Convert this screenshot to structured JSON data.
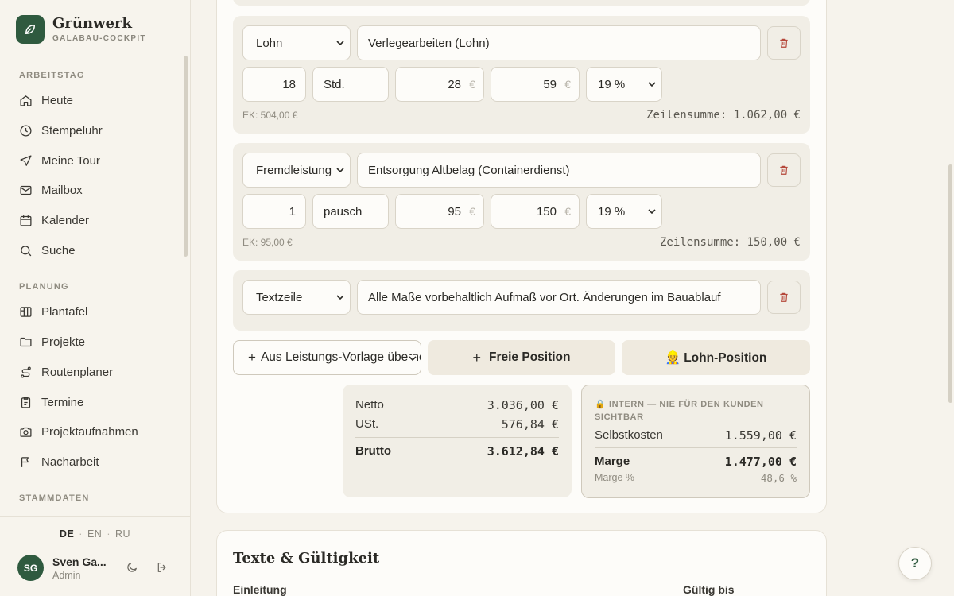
{
  "brand": {
    "name": "Grünwerk",
    "subtitle": "GALABAU-COCKPIT"
  },
  "sidebar": {
    "sections": [
      {
        "title": "ARBEITSTAG",
        "items": [
          {
            "label": "Heute",
            "icon": "home-icon"
          },
          {
            "label": "Stempeluhr",
            "icon": "clock-icon"
          },
          {
            "label": "Meine Tour",
            "icon": "navigation-icon"
          },
          {
            "label": "Mailbox",
            "icon": "mail-icon"
          },
          {
            "label": "Kalender",
            "icon": "calendar-icon"
          },
          {
            "label": "Suche",
            "icon": "search-icon"
          }
        ]
      },
      {
        "title": "PLANUNG",
        "items": [
          {
            "label": "Plantafel",
            "icon": "board-icon"
          },
          {
            "label": "Projekte",
            "icon": "folder-icon"
          },
          {
            "label": "Routenplaner",
            "icon": "route-icon"
          },
          {
            "label": "Termine",
            "icon": "clipboard-icon"
          },
          {
            "label": "Projektaufnahmen",
            "icon": "camera-icon"
          },
          {
            "label": "Nacharbeit",
            "icon": "flag-icon"
          }
        ]
      },
      {
        "title": "STAMMDATEN",
        "items": []
      }
    ],
    "languages": [
      "DE",
      "EN",
      "RU"
    ],
    "active_language": "DE",
    "user": {
      "initials": "SG",
      "name": "Sven Ga...",
      "role": "Admin"
    }
  },
  "positions": [
    {
      "type": "Lohn",
      "description": "Verlegearbeiten (Lohn)",
      "qty": "18",
      "unit": "Std.",
      "ek_price": "28",
      "vk_price": "59",
      "vat": "19 %",
      "ek_total": "EK: 504,00 €",
      "line_total": "Zeilensumme: 1.062,00 €"
    },
    {
      "type": "Fremdleistung",
      "description": "Entsorgung Altbelag (Containerdienst)",
      "qty": "1",
      "unit": "pausch",
      "ek_price": "95",
      "vk_price": "150",
      "vat": "19 %",
      "ek_total": "EK: 95,00 €",
      "line_total": "Zeilensumme: 150,00 €"
    },
    {
      "type": "Textzeile",
      "description": "Alle Maße vorbehaltlich Aufmaß vor Ort. Änderungen im Bauablauf"
    }
  ],
  "currency_symbol": "€",
  "actions": {
    "template": "Aus Leistungs-Vorlage übernehmen",
    "free": "Freie Position",
    "lohn": "👷 Lohn-Position"
  },
  "totals": {
    "netto_label": "Netto",
    "netto": "3.036,00 €",
    "ust_label": "USt.",
    "ust": "576,84 €",
    "brutto_label": "Brutto",
    "brutto": "3.612,84 €"
  },
  "internal": {
    "title": "🔒 INTERN — NIE FÜR DEN KUNDEN SICHTBAR",
    "selbstkosten_label": "Selbstkosten",
    "selbstkosten": "1.559,00 €",
    "marge_label": "Marge",
    "marge": "1.477,00 €",
    "marge_pct_label": "Marge %",
    "marge_pct": "48,6 %"
  },
  "texts_section": {
    "title": "Texte & Gültigkeit",
    "intro_label": "Einleitung",
    "valid_label": "Gültig bis"
  },
  "help_label": "?",
  "colors": {
    "accent": "#2f5a3f",
    "danger": "#b5473a",
    "background": "#f6f3ec"
  }
}
